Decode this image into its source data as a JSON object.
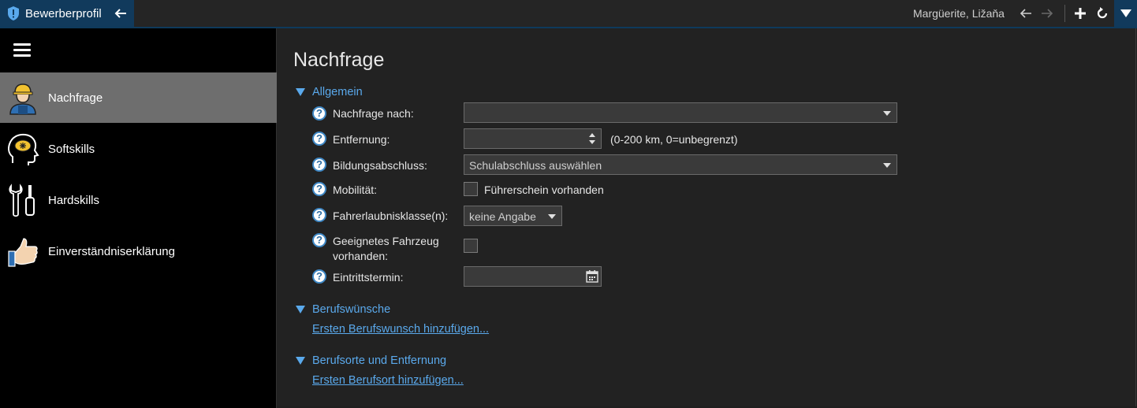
{
  "app": {
    "title": "Bewerberprofil",
    "user": "Margüerite, Ližaňa"
  },
  "sidebar": {
    "items": [
      {
        "label": "Nachfrage",
        "icon": "worker-icon",
        "active": true
      },
      {
        "label": "Softskills",
        "icon": "head-brain-icon",
        "active": false
      },
      {
        "label": "Hardskills",
        "icon": "tools-icon",
        "active": false
      },
      {
        "label": "Einverständniserklärung",
        "icon": "thumbs-up-icon",
        "active": false
      }
    ]
  },
  "main": {
    "title": "Nachfrage",
    "sections": {
      "allgemein": "Allgemein",
      "berufswuensche": "Berufswünsche",
      "berufsorte": "Berufsorte und Entfernung"
    },
    "fields": {
      "nachfrage_nach": {
        "label": "Nachfrage nach:",
        "value": ""
      },
      "entfernung": {
        "label": "Entfernung:",
        "value": "",
        "hint": "(0-200 km, 0=unbegrenzt)"
      },
      "bildungsabschluss": {
        "label": "Bildungsabschluss:",
        "value": "Schulabschluss auswählen"
      },
      "mobilitaet": {
        "label": "Mobilität:",
        "checkbox_label": "Führerschein vorhanden",
        "checked": false
      },
      "fahrerlaubnisklasse": {
        "label": "Fahrerlaubnisklasse(n):",
        "value": "keine Angabe"
      },
      "fahrzeug": {
        "label_line1": "Geeignetes Fahrzeug",
        "label_line2": "vorhanden:",
        "checked": false
      },
      "eintrittstermin": {
        "label": "Eintrittstermin:",
        "value": ""
      }
    },
    "links": {
      "berufswunsch": "Ersten Berufswunsch hinzufügen...",
      "berufsort": "Ersten Berufsort hinzufügen..."
    }
  },
  "colors": {
    "accent": "#5aa9ec",
    "titlebar_chip": "#113a5c",
    "sidebar_bg": "#000000",
    "sidebar_active": "#6e6e6e",
    "main_bg": "#222222"
  }
}
